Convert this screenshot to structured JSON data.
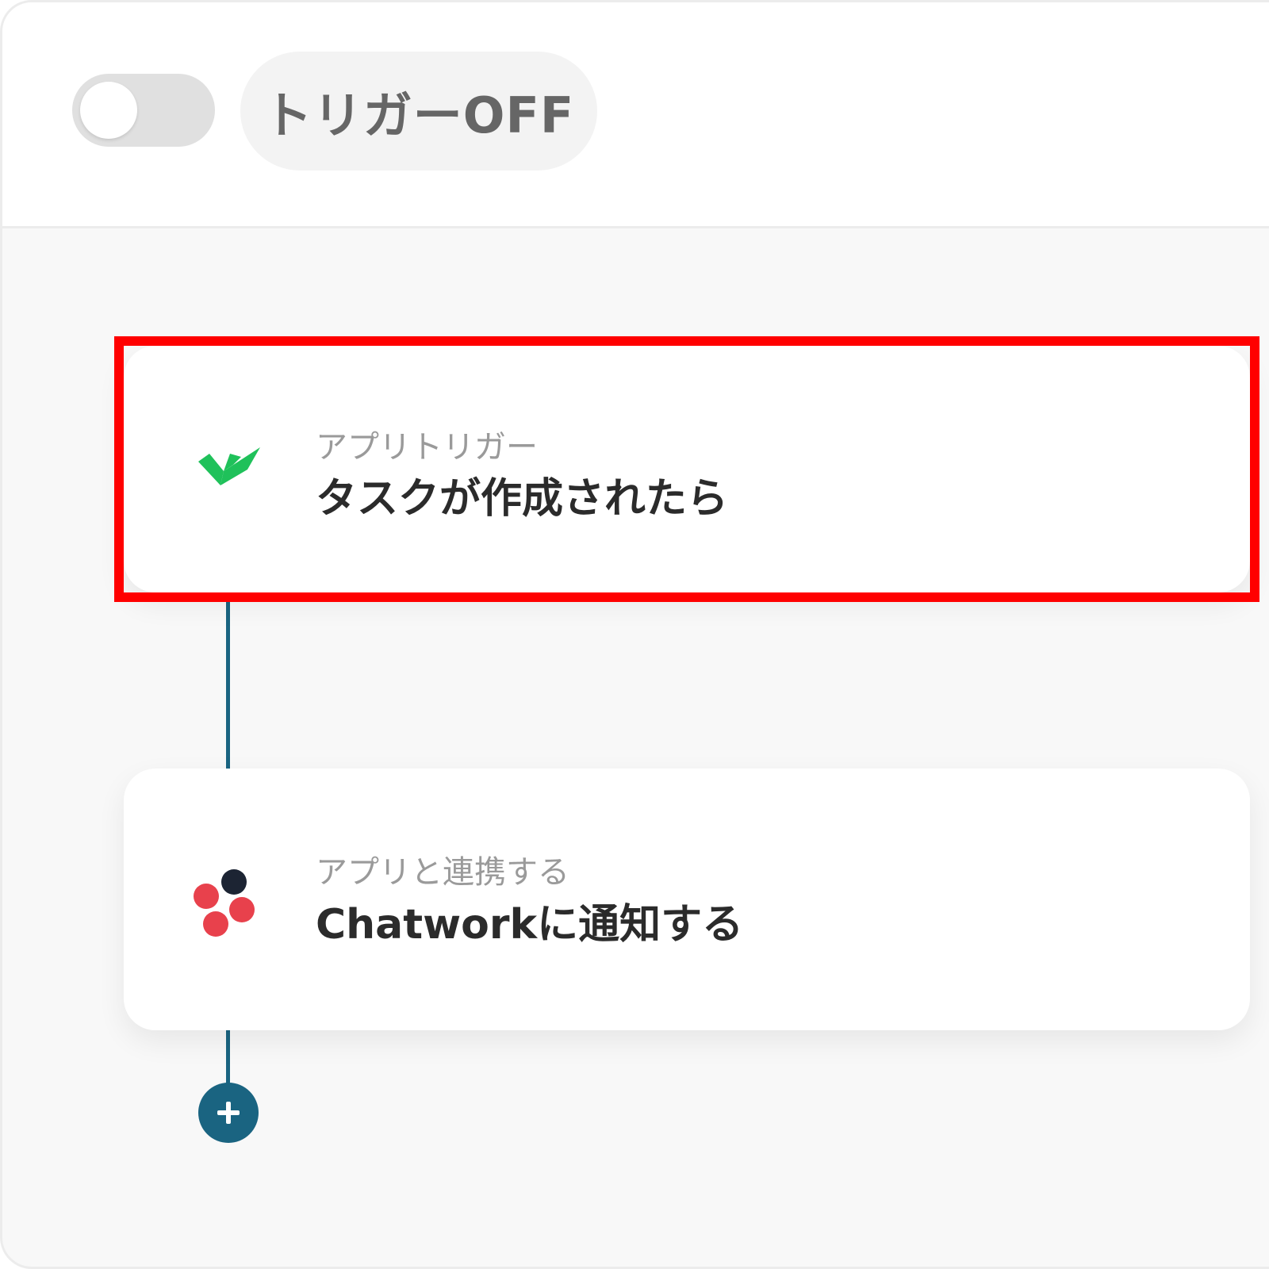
{
  "header": {
    "toggle_state": "off",
    "trigger_label": "トリガーOFF"
  },
  "flow": {
    "steps": [
      {
        "category": "アプリトリガー",
        "title": "タスクが作成されたら",
        "icon": "wrike-checkmark-icon",
        "highlighted": true
      },
      {
        "category": "アプリと連携する",
        "title": "Chatworkに通知する",
        "icon": "chatwork-logo-icon",
        "highlighted": false
      }
    ],
    "add_button_icon": "plus-icon"
  },
  "colors": {
    "accent": "#1a6481",
    "highlight": "#ff0000",
    "wrike_green": "#1fc15a",
    "chatwork_red": "#e8414c",
    "chatwork_dark": "#1c2433"
  }
}
